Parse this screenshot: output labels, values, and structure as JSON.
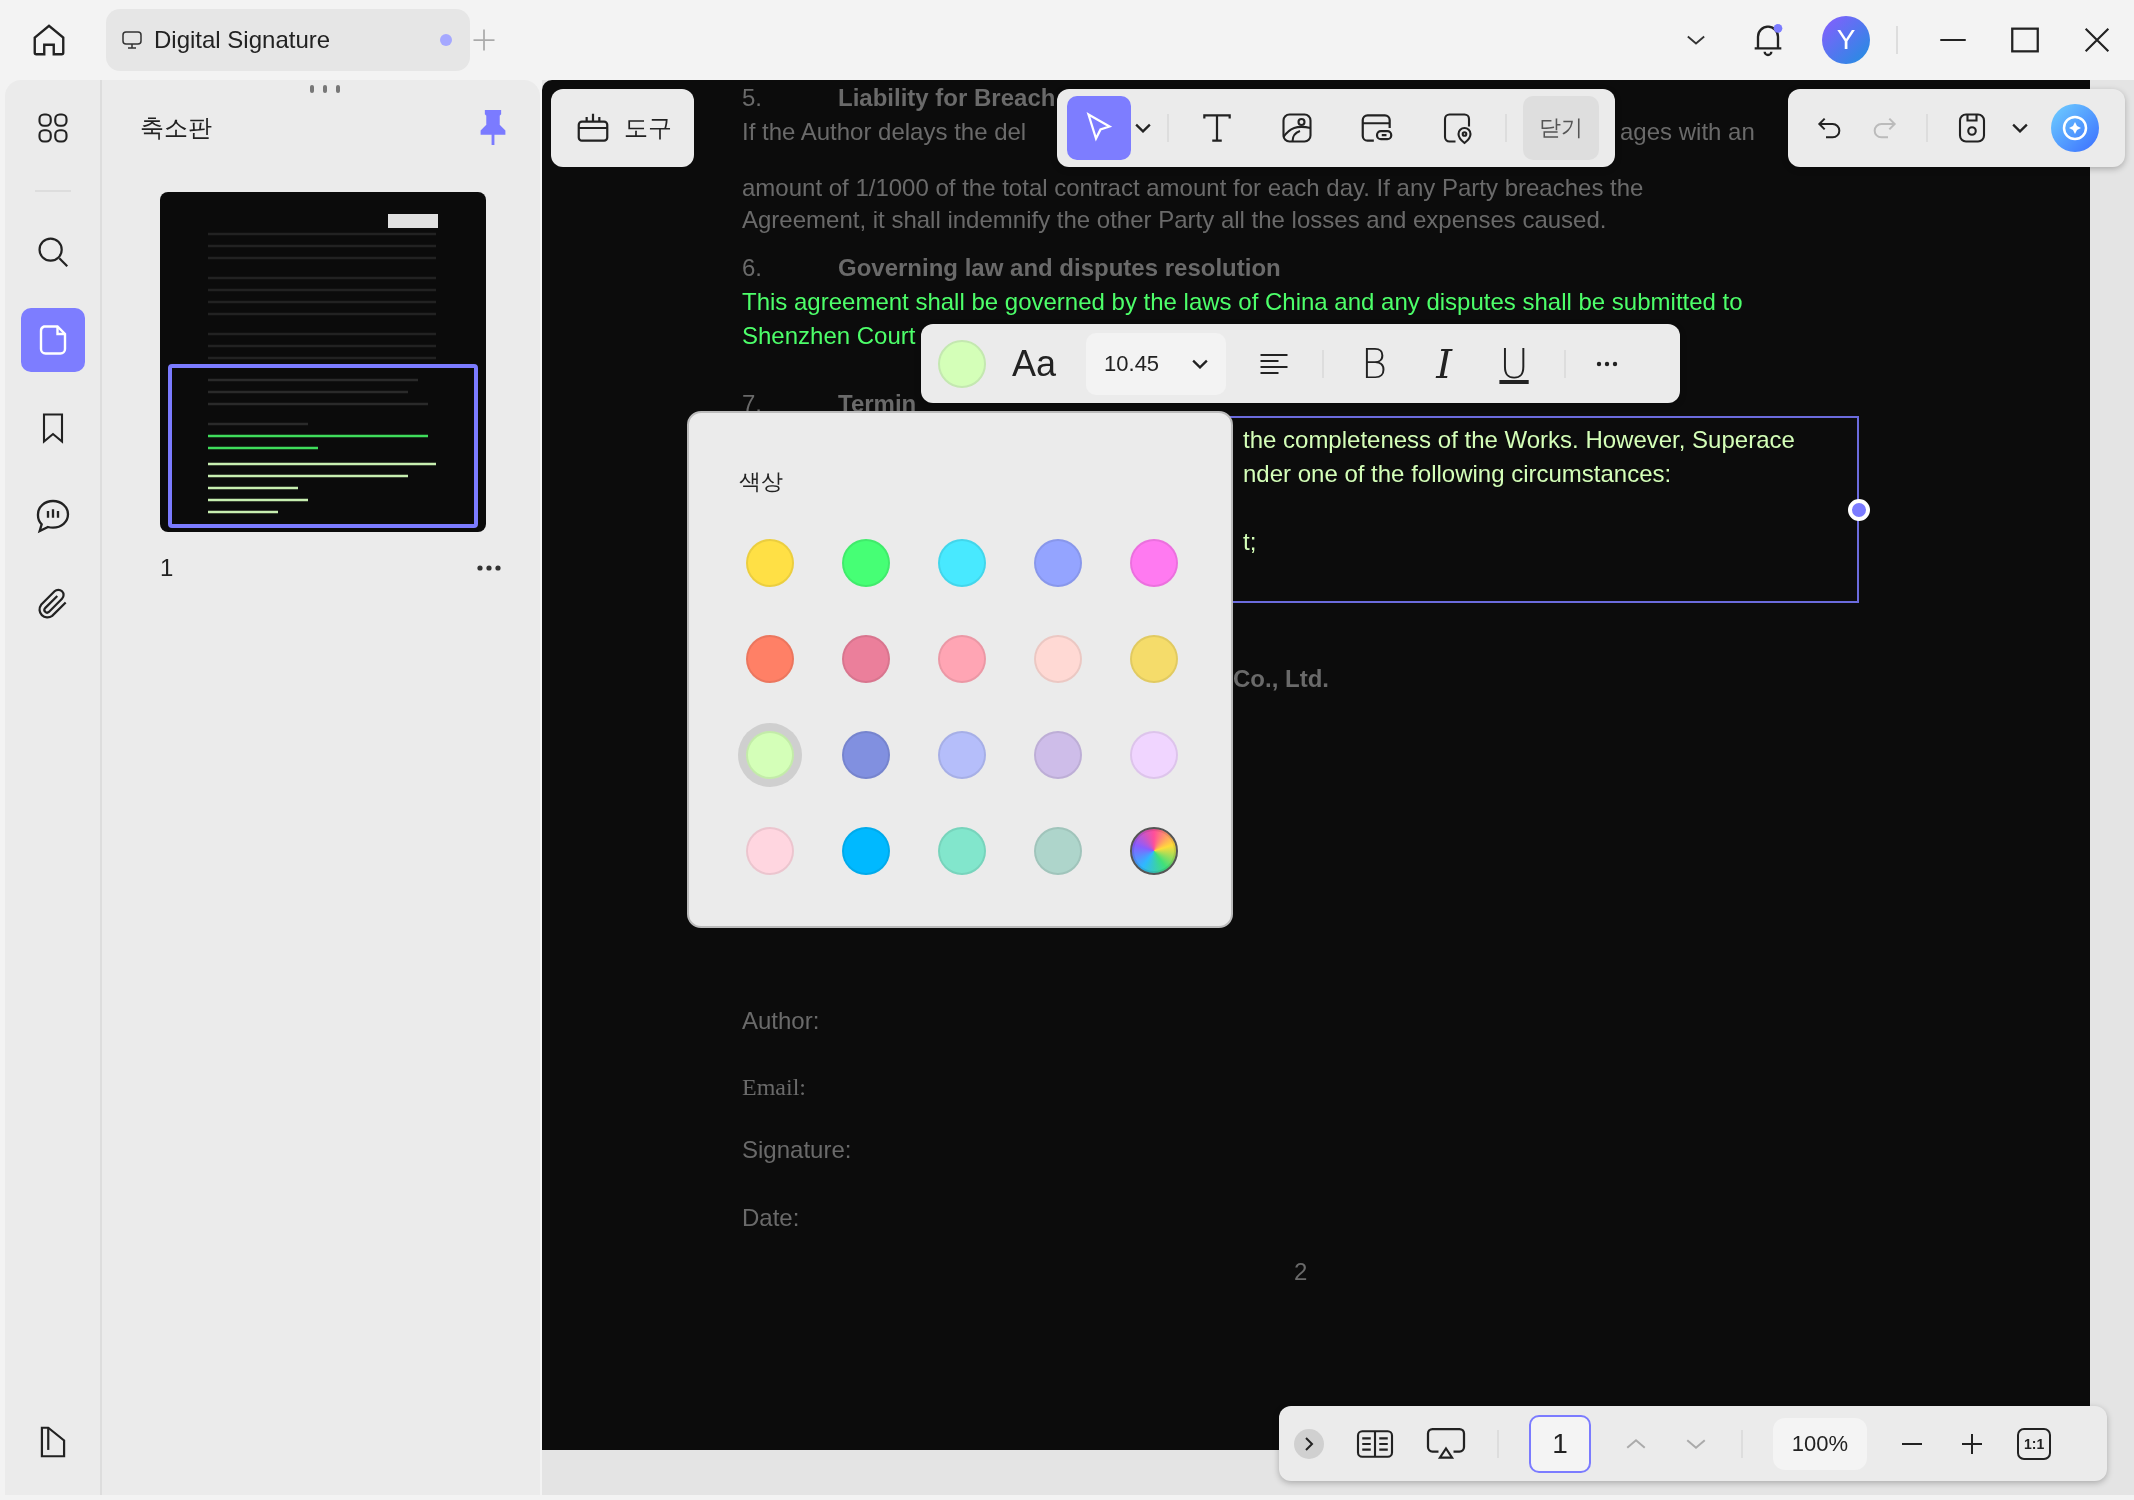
{
  "tab": {
    "title": "Digital Signature",
    "modified": true
  },
  "account": {
    "initial": "Y",
    "unread_notifications": true
  },
  "rail": [
    {
      "kind": "thumbnails",
      "selected": false
    },
    {
      "kind": "search",
      "selected": false
    },
    {
      "kind": "pages",
      "selected": true
    },
    {
      "kind": "bookmarks",
      "selected": false
    },
    {
      "kind": "comments",
      "selected": false
    },
    {
      "kind": "attachments",
      "selected": false
    }
  ],
  "sidebar": {
    "title": "축소판",
    "pinned": true,
    "pages": [
      {
        "label": "1"
      }
    ]
  },
  "tools_button": {
    "label": "도구"
  },
  "toolbar": {
    "tools": [
      {
        "kind": "select",
        "selected": true
      },
      {
        "kind": "text",
        "selected": false
      },
      {
        "kind": "image",
        "selected": false
      },
      {
        "kind": "link",
        "selected": false
      },
      {
        "kind": "place",
        "selected": false
      }
    ],
    "close_label": "닫기"
  },
  "history": {
    "undo_disabled": false,
    "redo_disabled": true
  },
  "document": {
    "fragments": [
      {
        "kind": "number",
        "text": "5."
      },
      {
        "kind": "heading",
        "text": "Liability for Breach"
      },
      {
        "kind": "body",
        "text": "If the Author delays the del"
      },
      {
        "kind": "body",
        "text": "ages with an"
      },
      {
        "kind": "body",
        "text": "amount of 1/1000 of the total contract amount for each day. If any Party breaches the"
      },
      {
        "kind": "body",
        "text": "Agreement, it shall indemnify the other Party all the losses and expenses caused."
      },
      {
        "kind": "number",
        "text": "6."
      },
      {
        "kind": "heading",
        "text": "Governing law and disputes resolution"
      },
      {
        "kind": "highlight",
        "text": "This agreement shall be governed by the laws of China and any disputes shall be submitted to"
      },
      {
        "kind": "highlight",
        "text": "Shenzhen Court"
      },
      {
        "kind": "number",
        "text": "7."
      },
      {
        "kind": "heading",
        "text": "Termin"
      },
      {
        "kind": "edited",
        "text": "the completeness of the Works. However, Superace"
      },
      {
        "kind": "edited",
        "text": "nder one of the following circumstances:"
      },
      {
        "kind": "edited",
        "text": "t;"
      },
      {
        "kind": "heading",
        "text": "Co., Ltd."
      },
      {
        "kind": "body",
        "text": "Author:"
      },
      {
        "kind": "serif",
        "text": "Email:"
      },
      {
        "kind": "body",
        "text": "Signature:"
      },
      {
        "kind": "body",
        "text": "Date:"
      },
      {
        "kind": "body",
        "text": "2"
      }
    ]
  },
  "format_bar": {
    "font_label": "Aa",
    "font_size": "10.45",
    "styles": [
      {
        "kind": "bold",
        "label": "B"
      },
      {
        "kind": "italic",
        "label": "I"
      },
      {
        "kind": "underline",
        "label": "U"
      }
    ]
  },
  "color_popup": {
    "title": "색상",
    "swatches": [
      {
        "kind": "color",
        "color": "#ffe045",
        "selected": false
      },
      {
        "kind": "color",
        "color": "#46ff75",
        "selected": false
      },
      {
        "kind": "color",
        "color": "#48e9ff",
        "selected": false
      },
      {
        "kind": "color",
        "color": "#94a4ff",
        "selected": false
      },
      {
        "kind": "color",
        "color": "#ff7af1",
        "selected": false
      },
      {
        "kind": "color",
        "color": "#ff8066",
        "selected": false
      },
      {
        "kind": "color",
        "color": "#eb7f9b",
        "selected": false
      },
      {
        "kind": "color",
        "color": "#ffa5b4",
        "selected": false
      },
      {
        "kind": "color",
        "color": "#ffd9d4",
        "selected": false
      },
      {
        "kind": "color",
        "color": "#f5dc6a",
        "selected": false
      },
      {
        "kind": "color",
        "color": "#d4ffb8",
        "selected": true
      },
      {
        "kind": "color",
        "color": "#8190e0",
        "selected": false
      },
      {
        "kind": "color",
        "color": "#b5befa",
        "selected": false
      },
      {
        "kind": "color",
        "color": "#cebde9",
        "selected": false
      },
      {
        "kind": "color",
        "color": "#f0d5ff",
        "selected": false
      },
      {
        "kind": "color",
        "color": "#ffd6e0",
        "selected": false
      },
      {
        "kind": "color",
        "color": "#00b9ff",
        "selected": false
      },
      {
        "kind": "color",
        "color": "#82e6cc",
        "selected": false
      },
      {
        "kind": "color",
        "color": "#aed5cb",
        "selected": false
      },
      {
        "kind": "custom",
        "selected": false
      }
    ]
  },
  "page_nav": {
    "page": "1",
    "prev_disabled": true,
    "next_disabled": true,
    "zoom": "100%",
    "actual_size": "1:1"
  }
}
